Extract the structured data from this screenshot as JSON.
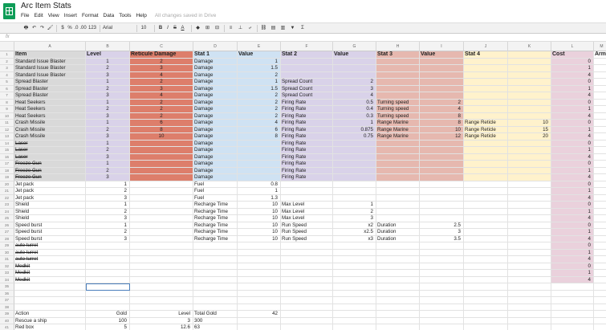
{
  "doc": {
    "title": "Arc Item Stats",
    "star": "☆",
    "saved_status": "All changes saved in Drive"
  },
  "menu": [
    "File",
    "Edit",
    "View",
    "Insert",
    "Format",
    "Data",
    "Tools",
    "Help"
  ],
  "toolbar": {
    "currency": "$",
    "percent": "%",
    "decimal_more": ".0",
    "decimal_less": ".00",
    "number_format": "123",
    "font_name": "Arial",
    "font_size": "10",
    "bold": "B",
    "italic": "I",
    "strike": "S",
    "underline": "A",
    "sum": "Σ"
  },
  "fx": {
    "label": "fx",
    "value": ""
  },
  "columns": [
    "A",
    "B",
    "C",
    "D",
    "E",
    "F",
    "G",
    "H",
    "I",
    "J",
    "K",
    "L",
    "M"
  ],
  "colors": {
    "grey": "#d9d9d9",
    "lavender": "#d9d2e9",
    "red": "#dd7e6b",
    "blue": "#cfe2f3",
    "salmon": "#e6b8af",
    "yellow": "#fff2cc",
    "pink": "#ead1dc",
    "logo": "#0f9d58"
  },
  "header": [
    "Item",
    "Level",
    "Reticule Damage",
    "Stat 1",
    "Value",
    "Stat 2",
    "Value",
    "Stat 3",
    "Value",
    "Stat 4",
    "",
    "Cost",
    "Arm"
  ],
  "rows": [
    [
      "Standard Issue Blaster",
      "1",
      "2",
      "Damage",
      "1",
      "",
      "",
      "",
      "",
      "",
      "",
      "0",
      ""
    ],
    [
      "Standard Issue Blaster",
      "2",
      "3",
      "Damage",
      "1.5",
      "",
      "",
      "",
      "",
      "",
      "",
      "1",
      ""
    ],
    [
      "Standard Issue Blaster",
      "3",
      "4",
      "Damage",
      "2",
      "",
      "",
      "",
      "",
      "",
      "",
      "4",
      ""
    ],
    [
      "Spread Blaster",
      "1",
      "2",
      "Damage",
      "1",
      "Spread Count",
      "2",
      "",
      "",
      "",
      "",
      "0",
      ""
    ],
    [
      "Spread Blaster",
      "2",
      "3",
      "Damage",
      "1.5",
      "Spread Count",
      "3",
      "",
      "",
      "",
      "",
      "1",
      ""
    ],
    [
      "Spread Blaster",
      "3",
      "4",
      "Damage",
      "2",
      "Spread Count",
      "4",
      "",
      "",
      "",
      "",
      "4",
      ""
    ],
    [
      "Heat Seekers",
      "1",
      "2",
      "Damage",
      "2",
      "Firing Rate",
      "0.5",
      "Turning speed",
      "2",
      "",
      "",
      "0",
      ""
    ],
    [
      "Heat Seekers",
      "2",
      "2",
      "Damage",
      "2",
      "Firing Rate",
      "0.4",
      "Turning speed",
      "4",
      "",
      "",
      "1",
      ""
    ],
    [
      "Heat Seekers",
      "3",
      "2",
      "Damage",
      "2",
      "Firing Rate",
      "0.3",
      "Turning speed",
      "8",
      "",
      "",
      "4",
      ""
    ],
    [
      "Crash Missile",
      "1",
      "6",
      "Damage",
      "4",
      "Firing Rate",
      "1",
      "Range Marine",
      "8",
      "Range Reticle",
      "10",
      "0",
      ""
    ],
    [
      "Crash Missile",
      "2",
      "8",
      "Damage",
      "6",
      "Firing Rate",
      "0.875",
      "Range Marine",
      "10",
      "Range Reticle",
      "15",
      "1",
      ""
    ],
    [
      "Crash Missile",
      "3",
      "10",
      "Damage",
      "8",
      "Firing Rate",
      "0.75",
      "Range Marine",
      "12",
      "Range Reticle",
      "20",
      "4",
      ""
    ],
    [
      "Laser",
      "1",
      "",
      "Damage",
      "",
      "Firing Rate",
      "",
      "",
      "",
      "",
      "",
      "0",
      ""
    ],
    [
      "Laser",
      "2",
      "",
      "Damage",
      "",
      "Firing Rate",
      "",
      "",
      "",
      "",
      "",
      "1",
      ""
    ],
    [
      "Laser",
      "3",
      "",
      "Damage",
      "",
      "Firing Rate",
      "",
      "",
      "",
      "",
      "",
      "4",
      ""
    ],
    [
      "Freeze Gun",
      "1",
      "",
      "Damage",
      "",
      "Firing Rate",
      "",
      "",
      "",
      "",
      "",
      "0",
      ""
    ],
    [
      "Freeze Gun",
      "2",
      "",
      "Damage",
      "",
      "Firing Rate",
      "",
      "",
      "",
      "",
      "",
      "1",
      ""
    ],
    [
      "Freeze Gun",
      "3",
      "",
      "Damage",
      "",
      "Firing Rate",
      "",
      "",
      "",
      "",
      "",
      "4",
      ""
    ],
    [
      "Jet pack",
      "1",
      "",
      "Fuel",
      "0.8",
      "",
      "",
      "",
      "",
      "",
      "",
      "0",
      ""
    ],
    [
      "Jet pack",
      "2",
      "",
      "Fuel",
      "1",
      "",
      "",
      "",
      "",
      "",
      "",
      "1",
      ""
    ],
    [
      "Jet pack",
      "3",
      "",
      "Fuel",
      "1.3",
      "",
      "",
      "",
      "",
      "",
      "",
      "4",
      ""
    ],
    [
      "Shield",
      "1",
      "",
      "Recharge Time",
      "10",
      "Max Level",
      "1",
      "",
      "",
      "",
      "",
      "0",
      ""
    ],
    [
      "Shield",
      "2",
      "",
      "Recharge Time",
      "10",
      "Max Level",
      "2",
      "",
      "",
      "",
      "",
      "1",
      ""
    ],
    [
      "Shield",
      "3",
      "",
      "Recharge Time",
      "10",
      "Max Level",
      "3",
      "",
      "",
      "",
      "",
      "4",
      ""
    ],
    [
      "Speed burst",
      "1",
      "",
      "Recharge Time",
      "10",
      "Run Speed",
      "x2",
      "Duration",
      "2.5",
      "",
      "",
      "0",
      ""
    ],
    [
      "Speed burst",
      "2",
      "",
      "Recharge Time",
      "10",
      "Run Speed",
      "x2.5",
      "Duration",
      "3",
      "",
      "",
      "1",
      ""
    ],
    [
      "Speed burst",
      "3",
      "",
      "Recharge Time",
      "10",
      "Run Speed",
      "x3",
      "Duration",
      "3.5",
      "",
      "",
      "4",
      ""
    ],
    [
      "auto turret",
      "",
      "",
      "",
      "",
      "",
      "",
      "",
      "",
      "",
      "",
      "0",
      ""
    ],
    [
      "auto turret",
      "",
      "",
      "",
      "",
      "",
      "",
      "",
      "",
      "",
      "",
      "1",
      ""
    ],
    [
      "auto turret",
      "",
      "",
      "",
      "",
      "",
      "",
      "",
      "",
      "",
      "",
      "4",
      ""
    ],
    [
      "Medkit",
      "",
      "",
      "",
      "",
      "",
      "",
      "",
      "",
      "",
      "",
      "0",
      ""
    ],
    [
      "Medkit",
      "",
      "",
      "",
      "",
      "",
      "",
      "",
      "",
      "",
      "",
      "1",
      ""
    ],
    [
      "Medkit",
      "",
      "",
      "",
      "",
      "",
      "",
      "",
      "",
      "",
      "",
      "4",
      ""
    ],
    [
      "",
      "",
      "",
      "",
      "",
      "",
      "",
      "",
      "",
      "",
      "",
      "",
      ""
    ],
    [
      "",
      "",
      "",
      "",
      "",
      "",
      "",
      "",
      "",
      "",
      "",
      "",
      ""
    ],
    [
      "",
      "",
      "",
      "",
      "",
      "",
      "",
      "",
      "",
      "",
      "",
      "",
      ""
    ],
    [
      "",
      "",
      "",
      "",
      "",
      "",
      "",
      "",
      "",
      "",
      "",
      "",
      ""
    ],
    [
      "Action",
      "Gold",
      "Level",
      "Total Gold",
      "42",
      "",
      "",
      "",
      "",
      "",
      "",
      "",
      ""
    ],
    [
      "Rescue a ship",
      "100",
      "3",
      "300",
      "",
      "",
      "",
      "",
      "",
      "",
      "",
      "",
      ""
    ],
    [
      "Red box",
      "5",
      "12.6",
      "63",
      "",
      "",
      "",
      "",
      "",
      "",
      "",
      "",
      ""
    ]
  ]
}
